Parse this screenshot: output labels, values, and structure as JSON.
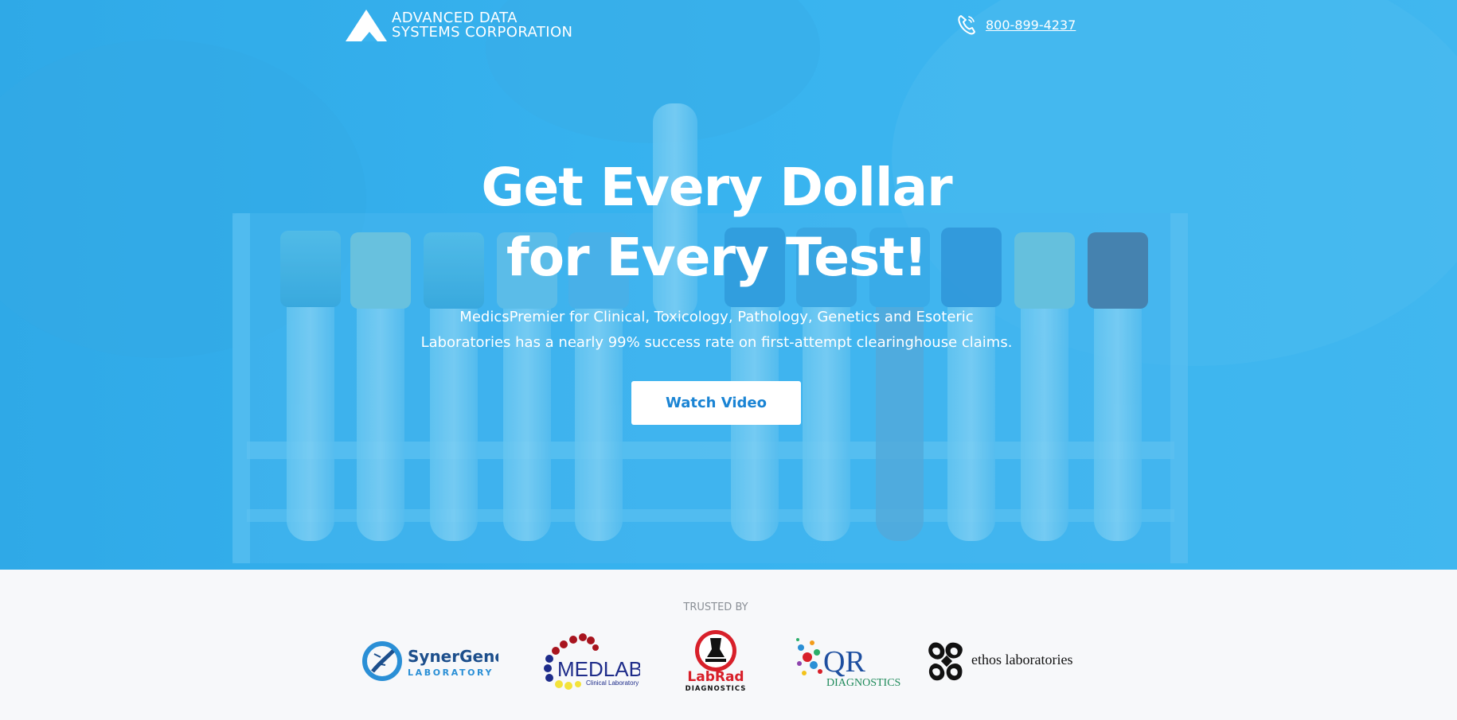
{
  "brand": {
    "line1": "ADVANCED DATA",
    "line2": "SYSTEMS CORPORATION"
  },
  "header": {
    "phone": "800-899-4237"
  },
  "hero": {
    "title_line1": "Get Every Dollar",
    "title_line2": "for Every Test!",
    "subtitle_line1": "MedicsPremier for Clinical, Toxicology, Pathology, Genetics and Esoteric",
    "subtitle_line2": "Laboratories has a nearly 99% success rate on first-attempt clearinghouse claims.",
    "cta_label": "Watch Video"
  },
  "trusted": {
    "label": "TRUSTED BY",
    "clients": [
      {
        "name": "SynerGene",
        "sub": "LABORATORY"
      },
      {
        "name": "MEDLAB",
        "sub": "Clinical Laboratory"
      },
      {
        "name": "LabRad",
        "sub": "DIAGNOSTICS"
      },
      {
        "name": "QR",
        "sub": "DIAGNOSTICS"
      },
      {
        "name": "ethos laboratories"
      }
    ]
  },
  "colors": {
    "hero_blue": "#39b2ee",
    "button_text": "#1a84d4",
    "page_bg": "#f7f8fa"
  }
}
